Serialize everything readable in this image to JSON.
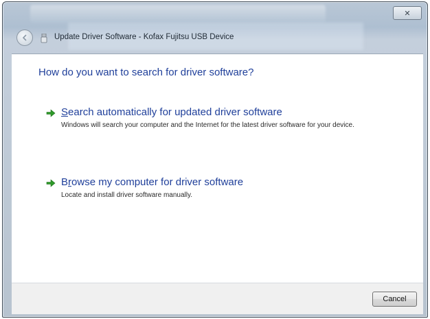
{
  "window": {
    "title": "Update Driver Software - Kofax Fujitsu USB Device",
    "close_glyph": "✕"
  },
  "main": {
    "heading": "How do you want to search for driver software?",
    "options": [
      {
        "hotkey": "S",
        "label_rest": "earch automatically for updated driver software",
        "description": "Windows will search your computer and the Internet for the latest driver software for your device."
      },
      {
        "hotkey": "r",
        "label_prefix": "B",
        "label_rest": "owse my computer for driver software",
        "description": "Locate and install driver software manually."
      }
    ]
  },
  "footer": {
    "cancel_label": "Cancel"
  },
  "colors": {
    "link_blue": "#1f3f9a",
    "arrow_green": "#2f9a2a"
  }
}
